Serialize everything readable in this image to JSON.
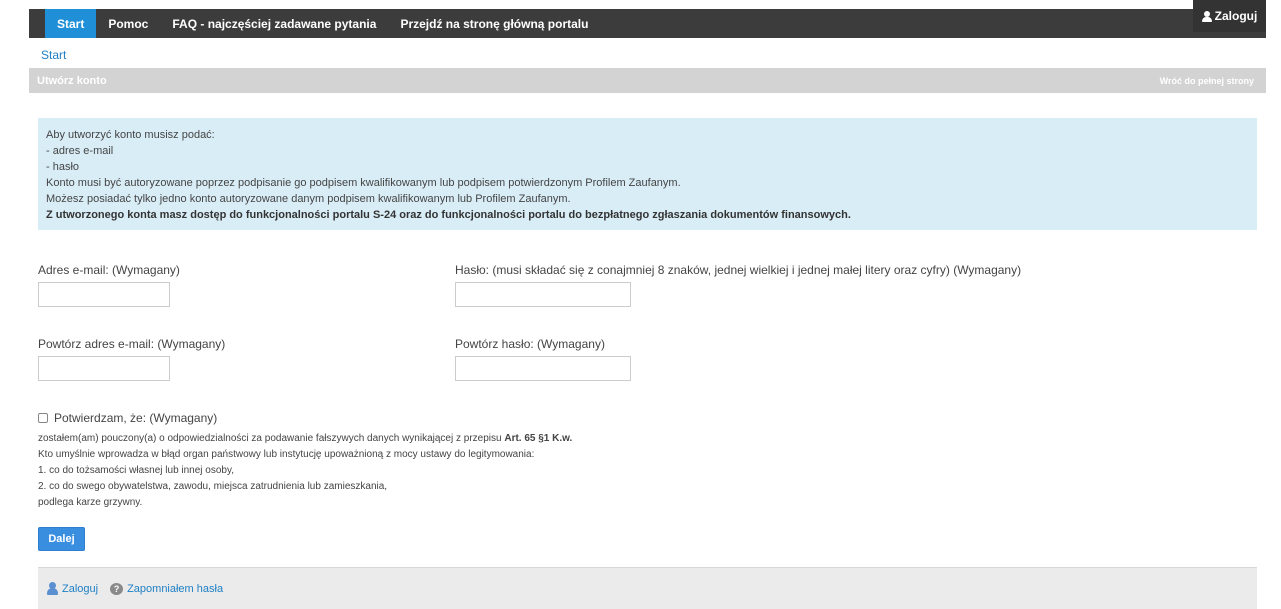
{
  "nav": {
    "items": [
      {
        "label": "Start",
        "active": true
      },
      {
        "label": "Pomoc",
        "active": false
      },
      {
        "label": "FAQ - najczęściej zadawane pytania",
        "active": false
      },
      {
        "label": "Przejdź na stronę główną portalu",
        "active": false
      }
    ],
    "login_label": "Zaloguj",
    "login_icon": "user-icon"
  },
  "breadcrumb": "Start",
  "panel": {
    "title": "Utwórz konto",
    "back_label": "Wróć do pełnej strony"
  },
  "info": {
    "lines": [
      "Aby utworzyć konto musisz podać:",
      "- adres e-mail",
      "- hasło",
      "Konto musi być autoryzowane poprzez podpisanie go podpisem kwalifikowanym lub podpisem potwierdzonym Profilem Zaufanym.",
      "Możesz posiadać tylko jedno konto autoryzowane danym podpisem kwalifikowanym lub Profilem Zaufanym."
    ],
    "bold_line": "Z utworzonego konta masz dostęp do funkcjonalności portalu S-24 oraz do funkcjonalności portalu do bezpłatnego zgłaszania dokumentów finansowych."
  },
  "form": {
    "email_label": "Adres e-mail: (Wymagany)",
    "email_value": "",
    "password_label": "Hasło: (musi składać się z conajmniej 8 znaków, jednej wielkiej i jednej małej litery oraz cyfry) (Wymagany)",
    "password_value": "",
    "email_repeat_label": "Powtórz adres e-mail: (Wymagany)",
    "email_repeat_value": "",
    "password_repeat_label": "Powtórz hasło: (Wymagany)",
    "password_repeat_value": "",
    "confirm_label": "Potwierdzam, że: (Wymagany)",
    "confirm_checked": false
  },
  "legal": {
    "line1_prefix": "zostałem(am) pouczony(a) o odpowiedzialności za podawanie fałszywych danych wynikającej z przepisu ",
    "line1_bold": "Art. 65 §1 K.w.",
    "line2": "Kto umyślnie wprowadza w błąd organ państwowy lub instytucję upoważnioną z mocy ustawy do legitymowania:",
    "line3": "1. co do tożsamości własnej lub innej osoby,",
    "line4": "2. co do swego obywatelstwa, zawodu, miejsca zatrudnienia lub zamieszkania,",
    "line5": "podlega karze grzywny."
  },
  "next_button": "Dalej",
  "footer": {
    "login_label": "Zaloguj",
    "login_icon": "person-icon",
    "forgot_label": "Zapomniałem hasła",
    "forgot_icon": "help-icon"
  }
}
